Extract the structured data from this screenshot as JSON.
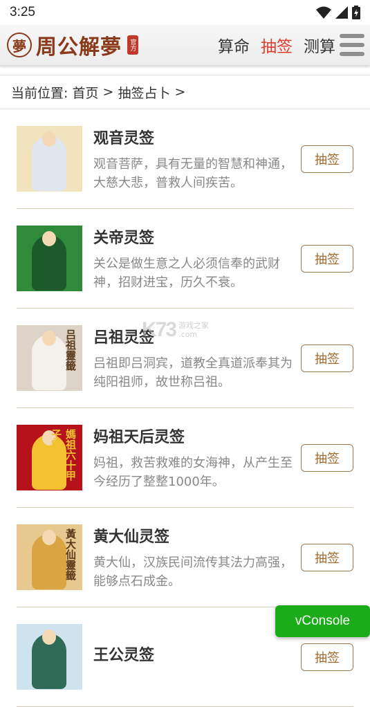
{
  "status_bar": {
    "time": "3:25"
  },
  "header": {
    "logo_char": "夢",
    "logo_text": "周公解夢",
    "logo_seal": "官方",
    "nav": [
      {
        "label": "算命",
        "active": false
      },
      {
        "label": "抽签",
        "active": true
      },
      {
        "label": "测算",
        "active": false
      }
    ]
  },
  "breadcrumb": {
    "prefix": "当前位置:",
    "home": "首页",
    "sep1": ">",
    "current": "抽签占卜",
    "sep2": ">"
  },
  "items": [
    {
      "title": "观音灵签",
      "desc": "观音菩萨，具有无量的智慧和神通，大慈大悲，普救人间疾苦。",
      "button": "抽签",
      "thumb_bg": "#f1e3bd",
      "thumb_fig": "#dfe6ee",
      "thumb_text": ""
    },
    {
      "title": "关帝灵签",
      "desc": "关公是做生意之人必须信奉的武财神，招财进宝，历久不衰。",
      "button": "抽签",
      "thumb_bg": "#2f8a3a",
      "thumb_fig": "#1c5a2c",
      "thumb_text": ""
    },
    {
      "title": "吕祖灵签",
      "desc": "吕祖即吕洞宾，道教全真道派奉其为纯阳祖师，故世称吕祖。",
      "button": "抽签",
      "thumb_bg": "#ddd3c6",
      "thumb_fig": "#f4f1ec",
      "thumb_text": "吕祖靈籤"
    },
    {
      "title": "妈祖天后灵签",
      "desc": "妈祖，救苦救难的女海神，从产生至今经历了整整1000年。",
      "button": "抽签",
      "thumb_bg": "#b5121b",
      "thumb_fig": "#f2c230",
      "thumb_text": "媽祖六十甲子靈籤"
    },
    {
      "title": "黄大仙灵签",
      "desc": "黄大仙，汉族民间流传其法力高强，能够点石成金。",
      "button": "抽签",
      "thumb_bg": "#e7c98f",
      "thumb_fig": "#d9a441",
      "thumb_text": "黃大仙靈籤"
    },
    {
      "title": "王公灵签",
      "desc": "",
      "button": "抽签",
      "thumb_bg": "#cfe3ee",
      "thumb_fig": "#2f6b56",
      "thumb_text": ""
    }
  ],
  "watermark": {
    "mark": "K73",
    "line1": "游戏之家",
    "line2": ".com"
  },
  "vconsole": {
    "label": "vConsole"
  },
  "colors": {
    "accent": "#e03a2b",
    "brand": "#8a3a1a",
    "button_text": "#a06a2c",
    "vconsole": "#1aad19"
  }
}
